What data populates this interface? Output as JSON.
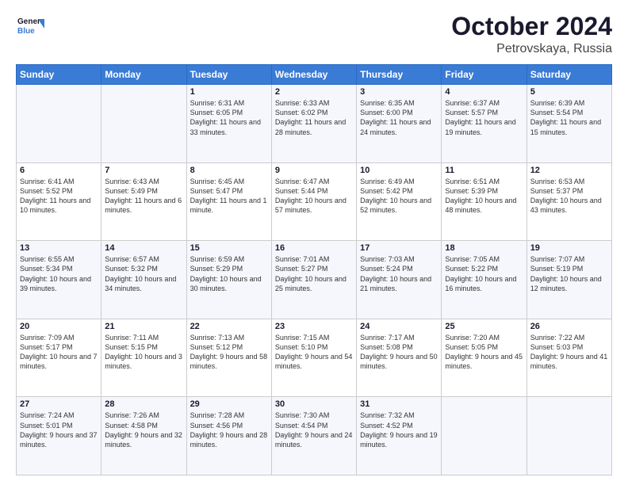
{
  "header": {
    "logo_line1": "General",
    "logo_line2": "Blue",
    "month_title": "October 2024",
    "location": "Petrovskaya, Russia"
  },
  "weekdays": [
    "Sunday",
    "Monday",
    "Tuesday",
    "Wednesday",
    "Thursday",
    "Friday",
    "Saturday"
  ],
  "weeks": [
    [
      {
        "day": "",
        "text": ""
      },
      {
        "day": "",
        "text": ""
      },
      {
        "day": "1",
        "text": "Sunrise: 6:31 AM\nSunset: 6:05 PM\nDaylight: 11 hours and 33 minutes."
      },
      {
        "day": "2",
        "text": "Sunrise: 6:33 AM\nSunset: 6:02 PM\nDaylight: 11 hours and 28 minutes."
      },
      {
        "day": "3",
        "text": "Sunrise: 6:35 AM\nSunset: 6:00 PM\nDaylight: 11 hours and 24 minutes."
      },
      {
        "day": "4",
        "text": "Sunrise: 6:37 AM\nSunset: 5:57 PM\nDaylight: 11 hours and 19 minutes."
      },
      {
        "day": "5",
        "text": "Sunrise: 6:39 AM\nSunset: 5:54 PM\nDaylight: 11 hours and 15 minutes."
      }
    ],
    [
      {
        "day": "6",
        "text": "Sunrise: 6:41 AM\nSunset: 5:52 PM\nDaylight: 11 hours and 10 minutes."
      },
      {
        "day": "7",
        "text": "Sunrise: 6:43 AM\nSunset: 5:49 PM\nDaylight: 11 hours and 6 minutes."
      },
      {
        "day": "8",
        "text": "Sunrise: 6:45 AM\nSunset: 5:47 PM\nDaylight: 11 hours and 1 minute."
      },
      {
        "day": "9",
        "text": "Sunrise: 6:47 AM\nSunset: 5:44 PM\nDaylight: 10 hours and 57 minutes."
      },
      {
        "day": "10",
        "text": "Sunrise: 6:49 AM\nSunset: 5:42 PM\nDaylight: 10 hours and 52 minutes."
      },
      {
        "day": "11",
        "text": "Sunrise: 6:51 AM\nSunset: 5:39 PM\nDaylight: 10 hours and 48 minutes."
      },
      {
        "day": "12",
        "text": "Sunrise: 6:53 AM\nSunset: 5:37 PM\nDaylight: 10 hours and 43 minutes."
      }
    ],
    [
      {
        "day": "13",
        "text": "Sunrise: 6:55 AM\nSunset: 5:34 PM\nDaylight: 10 hours and 39 minutes."
      },
      {
        "day": "14",
        "text": "Sunrise: 6:57 AM\nSunset: 5:32 PM\nDaylight: 10 hours and 34 minutes."
      },
      {
        "day": "15",
        "text": "Sunrise: 6:59 AM\nSunset: 5:29 PM\nDaylight: 10 hours and 30 minutes."
      },
      {
        "day": "16",
        "text": "Sunrise: 7:01 AM\nSunset: 5:27 PM\nDaylight: 10 hours and 25 minutes."
      },
      {
        "day": "17",
        "text": "Sunrise: 7:03 AM\nSunset: 5:24 PM\nDaylight: 10 hours and 21 minutes."
      },
      {
        "day": "18",
        "text": "Sunrise: 7:05 AM\nSunset: 5:22 PM\nDaylight: 10 hours and 16 minutes."
      },
      {
        "day": "19",
        "text": "Sunrise: 7:07 AM\nSunset: 5:19 PM\nDaylight: 10 hours and 12 minutes."
      }
    ],
    [
      {
        "day": "20",
        "text": "Sunrise: 7:09 AM\nSunset: 5:17 PM\nDaylight: 10 hours and 7 minutes."
      },
      {
        "day": "21",
        "text": "Sunrise: 7:11 AM\nSunset: 5:15 PM\nDaylight: 10 hours and 3 minutes."
      },
      {
        "day": "22",
        "text": "Sunrise: 7:13 AM\nSunset: 5:12 PM\nDaylight: 9 hours and 58 minutes."
      },
      {
        "day": "23",
        "text": "Sunrise: 7:15 AM\nSunset: 5:10 PM\nDaylight: 9 hours and 54 minutes."
      },
      {
        "day": "24",
        "text": "Sunrise: 7:17 AM\nSunset: 5:08 PM\nDaylight: 9 hours and 50 minutes."
      },
      {
        "day": "25",
        "text": "Sunrise: 7:20 AM\nSunset: 5:05 PM\nDaylight: 9 hours and 45 minutes."
      },
      {
        "day": "26",
        "text": "Sunrise: 7:22 AM\nSunset: 5:03 PM\nDaylight: 9 hours and 41 minutes."
      }
    ],
    [
      {
        "day": "27",
        "text": "Sunrise: 7:24 AM\nSunset: 5:01 PM\nDaylight: 9 hours and 37 minutes."
      },
      {
        "day": "28",
        "text": "Sunrise: 7:26 AM\nSunset: 4:58 PM\nDaylight: 9 hours and 32 minutes."
      },
      {
        "day": "29",
        "text": "Sunrise: 7:28 AM\nSunset: 4:56 PM\nDaylight: 9 hours and 28 minutes."
      },
      {
        "day": "30",
        "text": "Sunrise: 7:30 AM\nSunset: 4:54 PM\nDaylight: 9 hours and 24 minutes."
      },
      {
        "day": "31",
        "text": "Sunrise: 7:32 AM\nSunset: 4:52 PM\nDaylight: 9 hours and 19 minutes."
      },
      {
        "day": "",
        "text": ""
      },
      {
        "day": "",
        "text": ""
      }
    ]
  ]
}
